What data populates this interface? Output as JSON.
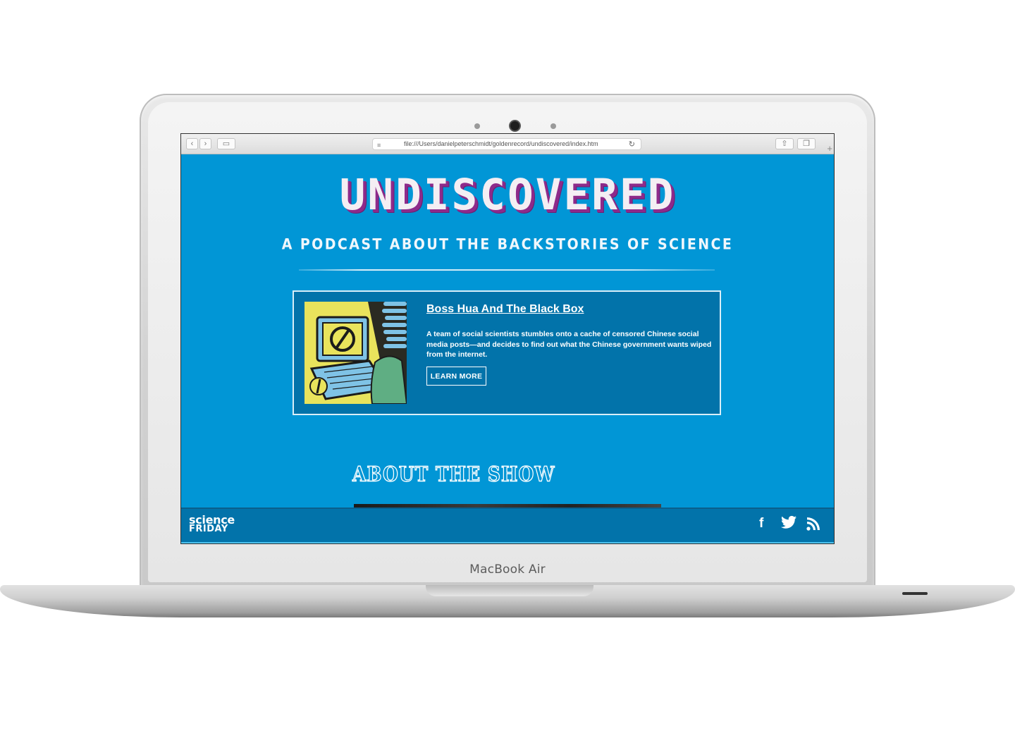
{
  "device": {
    "model_label": "MacBook Air"
  },
  "browser": {
    "url": "file:///Users/danielpeterschmidt/goldenrecord/undiscovered/index.htm",
    "back_icon": "chevron-left-icon",
    "forward_icon": "chevron-right-icon",
    "sidebar_icon": "sidebar-icon",
    "share_icon": "share-icon",
    "tabs_icon": "tabs-icon",
    "reload_icon": "reload-icon",
    "new_tab_icon": "plus-icon"
  },
  "site": {
    "logo": "UNDISCOVERED",
    "tagline": "A PODCAST ABOUT THE BACKSTORIES OF SCIENCE",
    "featured_episode": {
      "title": "Boss Hua And The Black Box",
      "description": "A team of social scientists stumbles onto a cache of censored Chinese social media posts—and decides to find out what the Chinese government wants wiped from the internet.",
      "cta": "LEARN MORE"
    },
    "about_heading": "ABOUT THE SHOW",
    "footer": {
      "brand_line1": "science",
      "brand_line2": "FRIDAY",
      "social": [
        {
          "name": "facebook-icon",
          "glyph": "f"
        },
        {
          "name": "twitter-icon",
          "glyph": "🐦"
        },
        {
          "name": "rss-icon",
          "glyph": "◝"
        }
      ]
    }
  },
  "colors": {
    "page_bg": "#0196d6",
    "card_bg": "#0273aa",
    "logo_shadow": "#8e2a8a"
  }
}
